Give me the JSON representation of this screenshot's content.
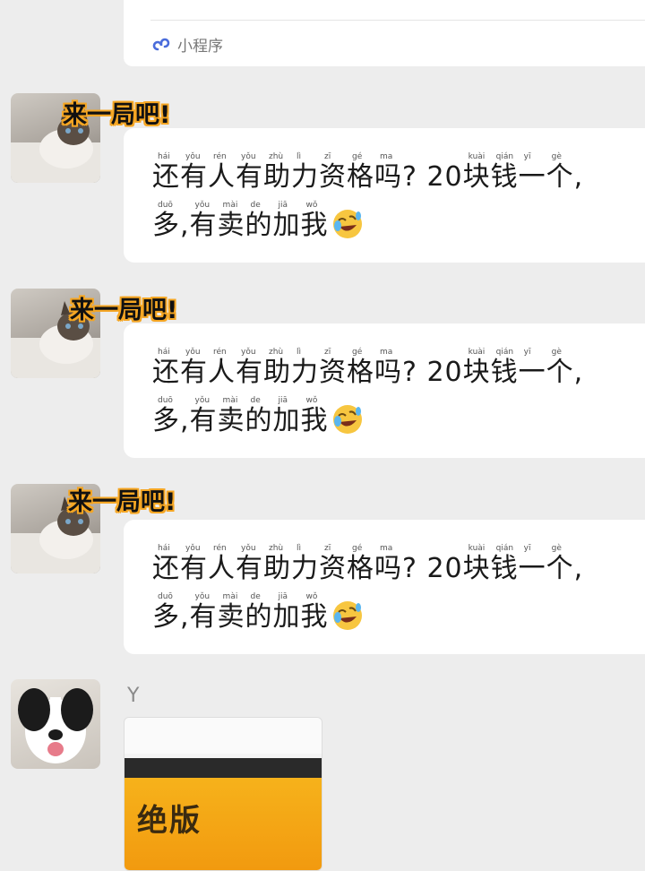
{
  "miniprogram": {
    "label": "小程序",
    "icon": "mini-program-icon",
    "accent": "#4a6cdb"
  },
  "messages": [
    {
      "nickname": "来一局吧!",
      "line1": [
        {
          "py": "hái",
          "ch": "还"
        },
        {
          "py": "yǒu",
          "ch": "有"
        },
        {
          "py": "rén",
          "ch": "人"
        },
        {
          "py": "yǒu",
          "ch": "有"
        },
        {
          "py": "zhù",
          "ch": "助"
        },
        {
          "py": "lì",
          "ch": "力"
        },
        {
          "py": "zī",
          "ch": "资"
        },
        {
          "py": "gé",
          "ch": "格"
        },
        {
          "py": "ma",
          "ch": "吗"
        },
        {
          "py": "",
          "ch": "? 20 "
        },
        {
          "py": "kuài",
          "ch": "块"
        },
        {
          "py": "qián",
          "ch": "钱"
        },
        {
          "py": "yī",
          "ch": "一"
        },
        {
          "py": "gè",
          "ch": "个,"
        }
      ],
      "line2": [
        {
          "py": "duō",
          "ch": "多,"
        },
        {
          "py": "yǒu",
          "ch": "有"
        },
        {
          "py": "mài",
          "ch": "卖"
        },
        {
          "py": "de",
          "ch": "的"
        },
        {
          "py": "jiā",
          "ch": "加"
        },
        {
          "py": "wǒ",
          "ch": "我"
        }
      ],
      "emoji": "rolling-laughing-emoji"
    },
    {
      "nickname": "来一局吧!",
      "line1": [
        {
          "py": "hái",
          "ch": "还"
        },
        {
          "py": "yǒu",
          "ch": "有"
        },
        {
          "py": "rén",
          "ch": "人"
        },
        {
          "py": "yǒu",
          "ch": "有"
        },
        {
          "py": "zhù",
          "ch": "助"
        },
        {
          "py": "lì",
          "ch": "力"
        },
        {
          "py": "zī",
          "ch": "资"
        },
        {
          "py": "gé",
          "ch": "格"
        },
        {
          "py": "ma",
          "ch": "吗"
        },
        {
          "py": "",
          "ch": "? 20 "
        },
        {
          "py": "kuài",
          "ch": "块"
        },
        {
          "py": "qián",
          "ch": "钱"
        },
        {
          "py": "yī",
          "ch": "一"
        },
        {
          "py": "gè",
          "ch": "个,"
        }
      ],
      "line2": [
        {
          "py": "duō",
          "ch": "多,"
        },
        {
          "py": "yǒu",
          "ch": "有"
        },
        {
          "py": "mài",
          "ch": "卖"
        },
        {
          "py": "de",
          "ch": "的"
        },
        {
          "py": "jiā",
          "ch": "加"
        },
        {
          "py": "wǒ",
          "ch": "我"
        }
      ],
      "emoji": "rolling-laughing-emoji"
    },
    {
      "nickname": "来一局吧!",
      "line1": [
        {
          "py": "hái",
          "ch": "还"
        },
        {
          "py": "yǒu",
          "ch": "有"
        },
        {
          "py": "rén",
          "ch": "人"
        },
        {
          "py": "yǒu",
          "ch": "有"
        },
        {
          "py": "zhù",
          "ch": "助"
        },
        {
          "py": "lì",
          "ch": "力"
        },
        {
          "py": "zī",
          "ch": "资"
        },
        {
          "py": "gé",
          "ch": "格"
        },
        {
          "py": "ma",
          "ch": "吗"
        },
        {
          "py": "",
          "ch": "? 20 "
        },
        {
          "py": "kuài",
          "ch": "块"
        },
        {
          "py": "qián",
          "ch": "钱"
        },
        {
          "py": "yī",
          "ch": "一"
        },
        {
          "py": "gè",
          "ch": "个,"
        }
      ],
      "line2": [
        {
          "py": "duō",
          "ch": "多,"
        },
        {
          "py": "yǒu",
          "ch": "有"
        },
        {
          "py": "mài",
          "ch": "卖"
        },
        {
          "py": "de",
          "ch": "的"
        },
        {
          "py": "jiā",
          "ch": "加"
        },
        {
          "py": "wǒ",
          "ch": "我"
        }
      ],
      "emoji": "rolling-laughing-emoji"
    }
  ],
  "last_sender": {
    "nickname": "Y",
    "attachment": {
      "title": "绝版"
    }
  }
}
